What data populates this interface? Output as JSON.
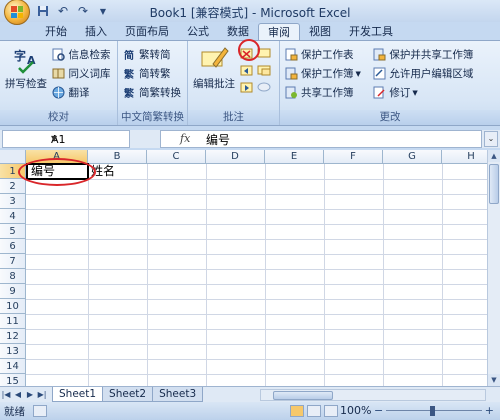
{
  "window": {
    "title": "Book1  [兼容模式] - Microsoft Excel"
  },
  "quick_access": [
    "save-icon",
    "undo-icon",
    "redo-icon",
    "customize-icon"
  ],
  "tabs": [
    {
      "label": "开始",
      "active": false
    },
    {
      "label": "插入",
      "active": false
    },
    {
      "label": "页面布局",
      "active": false
    },
    {
      "label": "公式",
      "active": false
    },
    {
      "label": "数据",
      "active": false
    },
    {
      "label": "审阅",
      "active": true
    },
    {
      "label": "视图",
      "active": false
    },
    {
      "label": "开发工具",
      "active": false
    }
  ],
  "ribbon": {
    "proofing": {
      "label": "校对",
      "spell_check": "拼写检查",
      "research": "信息检索",
      "thesaurus": "同义词库",
      "translate": "翻译"
    },
    "chinese_conversion": {
      "label": "中文简繁转换",
      "to_simplified": "繁转简",
      "to_traditional": "简转繁",
      "conversion": "简繁转换"
    },
    "comments": {
      "label": "批注",
      "edit_comment": "编辑批注"
    },
    "changes": {
      "label": "更改",
      "protect_sheet": "保护工作表",
      "protect_workbook": "保护工作簿",
      "share_workbook": "共享工作簿",
      "protect_share": "保护并共享工作簿",
      "allow_edit_ranges": "允许用户编辑区域",
      "track_changes": "修订"
    }
  },
  "formula_bar": {
    "name_box": "A1",
    "fx": "fx",
    "value": "编号"
  },
  "grid": {
    "columns": [
      "A",
      "B",
      "C",
      "D",
      "E",
      "F",
      "G",
      "H"
    ],
    "rows": [
      "1",
      "2",
      "3",
      "4",
      "5",
      "6",
      "7",
      "8",
      "9",
      "10",
      "11",
      "12",
      "13",
      "14",
      "15"
    ],
    "cells": {
      "A1": "编号",
      "B1": "姓名"
    },
    "selected": "A1"
  },
  "sheets": [
    {
      "label": "Sheet1",
      "active": true
    },
    {
      "label": "Sheet2",
      "active": false
    },
    {
      "label": "Sheet3",
      "active": false
    }
  ],
  "status": {
    "text": "就绪",
    "zoom": "100%"
  },
  "colors": {
    "accent": "#c5d9f1",
    "annotation": "#d9262a",
    "selected_header": "#f6c86b"
  }
}
